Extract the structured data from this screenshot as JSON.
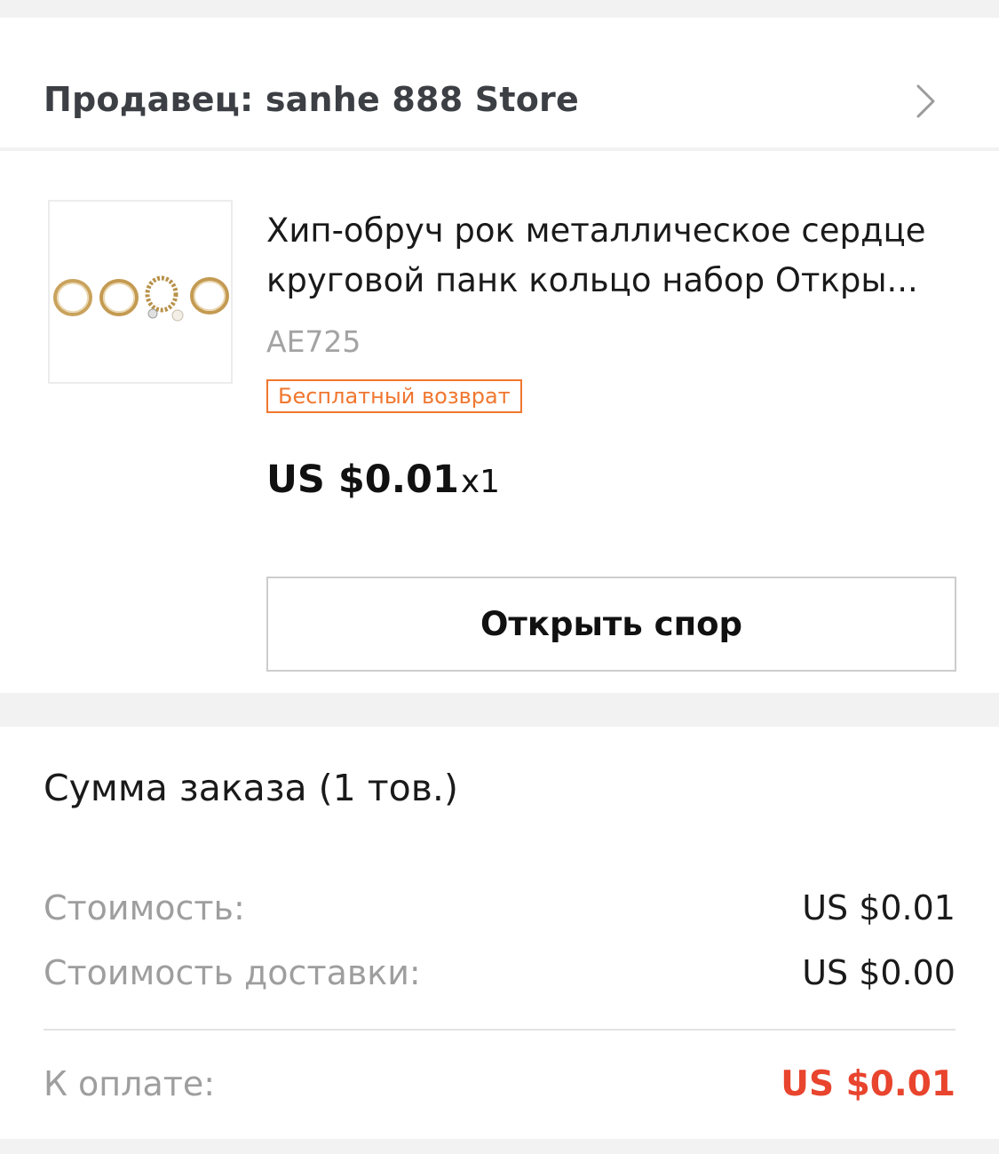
{
  "seller": {
    "label": "Продавец: sanhe 888 Store",
    "chevron_icon": "chevron-right-icon"
  },
  "product": {
    "image_icon": "ring-set-thumbnail",
    "title_line1": "Хип-обруч рок металлическое сердце",
    "title_line2": "круговой панк кольцо набор Откры...",
    "sku": "AE725",
    "badge": "Бесплатный возврат",
    "price": "US $0.01",
    "quantity": "x1",
    "dispute_button": "Открыть спор"
  },
  "summary": {
    "title": "Сумма заказа (1 тов.)",
    "cost_label": "Стоимость:",
    "cost_value": "US $0.01",
    "shipping_label": "Стоимость доставки:",
    "shipping_value": "US $0.00",
    "total_label": "К оплате:",
    "total_value": "US $0.01"
  },
  "colors": {
    "accent_orange": "#f0772f",
    "total_red": "#e8442e",
    "background": "#f2f2f2"
  }
}
